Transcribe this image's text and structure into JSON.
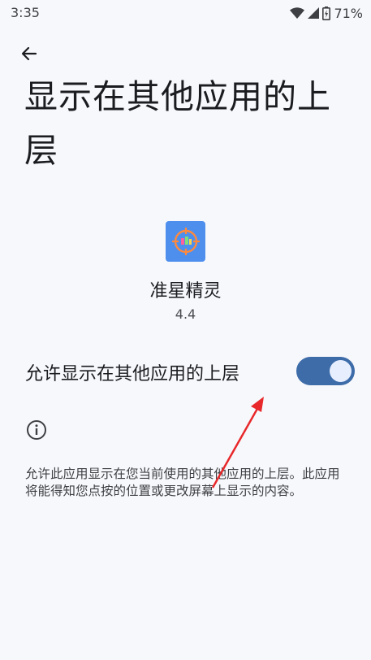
{
  "status_bar": {
    "time": "3:35",
    "battery": "71%",
    "icons": [
      "wifi-icon",
      "signal-icon",
      "battery-icon"
    ]
  },
  "page": {
    "title": "显示在其他应用的上层"
  },
  "app": {
    "name": "准星精灵",
    "version": "4.4",
    "icon": "crosshair-app-icon"
  },
  "permission": {
    "label": "允许显示在其他应用的上层",
    "enabled": true
  },
  "info": {
    "icon": "info-icon",
    "description": "允许此应用显示在您当前使用的其他应用的上层。此应用将能得知您点按的位置或更改屏幕上显示的内容。"
  },
  "colors": {
    "background": "#f7f8fb",
    "toggle_track": "#3d6ca9",
    "toggle_thumb": "#e7efff",
    "app_icon_bg": "#4e8fee",
    "annotation_arrow": "#e8282b"
  }
}
